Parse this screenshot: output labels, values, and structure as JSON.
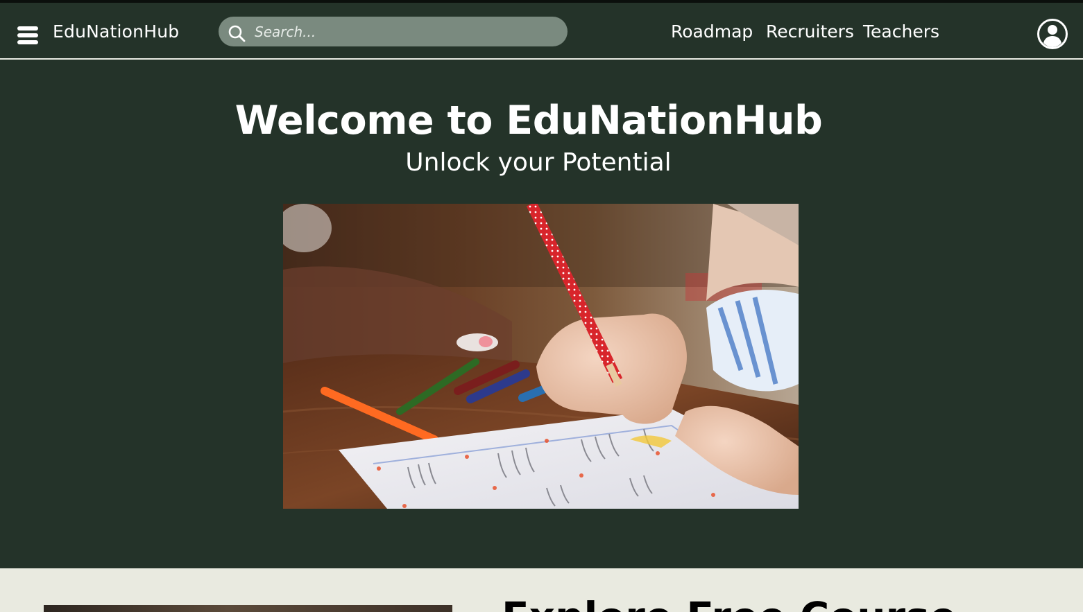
{
  "header": {
    "menu_icon": "hamburger-menu-icon",
    "brand": "EduNationHub",
    "search": {
      "placeholder": "Search...",
      "value": "",
      "icon": "search-icon"
    },
    "nav": [
      {
        "label": "Roadmap"
      },
      {
        "label": "Recruiters"
      },
      {
        "label": "Teachers"
      }
    ],
    "account_icon": "user-circle-icon"
  },
  "hero": {
    "title": "Welcome to EduNationHub",
    "subtitle": "Unlock your Potential"
  },
  "lower_section": {
    "heading": "Explore Free Course"
  },
  "colors": {
    "background": "#243329",
    "search_field": "#7a8a7f",
    "lower_background": "#e9eae0",
    "text": "#ffffff"
  }
}
